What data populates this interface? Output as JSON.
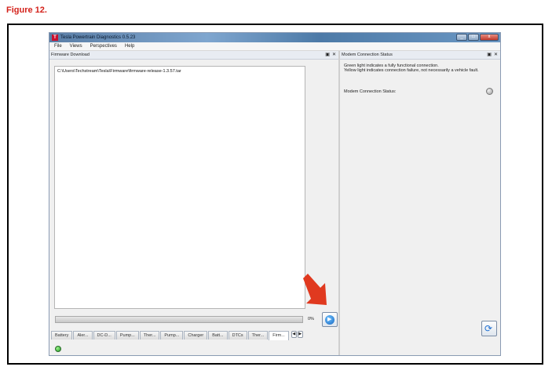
{
  "figure_caption": "Figure 12.",
  "window": {
    "title": "Tesla Powertrain Diagnostics 0.5.23",
    "icon": "tesla-icon",
    "controls": [
      "minimize-icon",
      "restore-icon",
      "close-icon"
    ]
  },
  "menu": [
    "File",
    "Views",
    "Perspectives",
    "Help"
  ],
  "firmware_panel": {
    "title": "Firmware Download",
    "file_path": "C:\\Users\\Techstream\\Tesla\\Firmware\\firmware-release-1.3.57.tar",
    "progress_text": "0%",
    "progress_value": 0
  },
  "tabs": [
    "Battery",
    "Aler...",
    "DC-D...",
    "Pump...",
    "Ther...",
    "Pump...",
    "Charger",
    "Batt...",
    "DTCs",
    "Ther...",
    "Firm..."
  ],
  "active_tab": "Firm...",
  "modem_panel": {
    "title": "Modem Connection Status",
    "line1": "Green light indicates a fully functional connection.",
    "line2": "Yellow light indicates connection failure, not necessarily a vehicle fault.",
    "status_label": "Modem Connection Status:"
  },
  "colors": {
    "caption_red": "#d4221b",
    "arrow_red": "#e0391f",
    "status_green": "#1e9a1e"
  }
}
